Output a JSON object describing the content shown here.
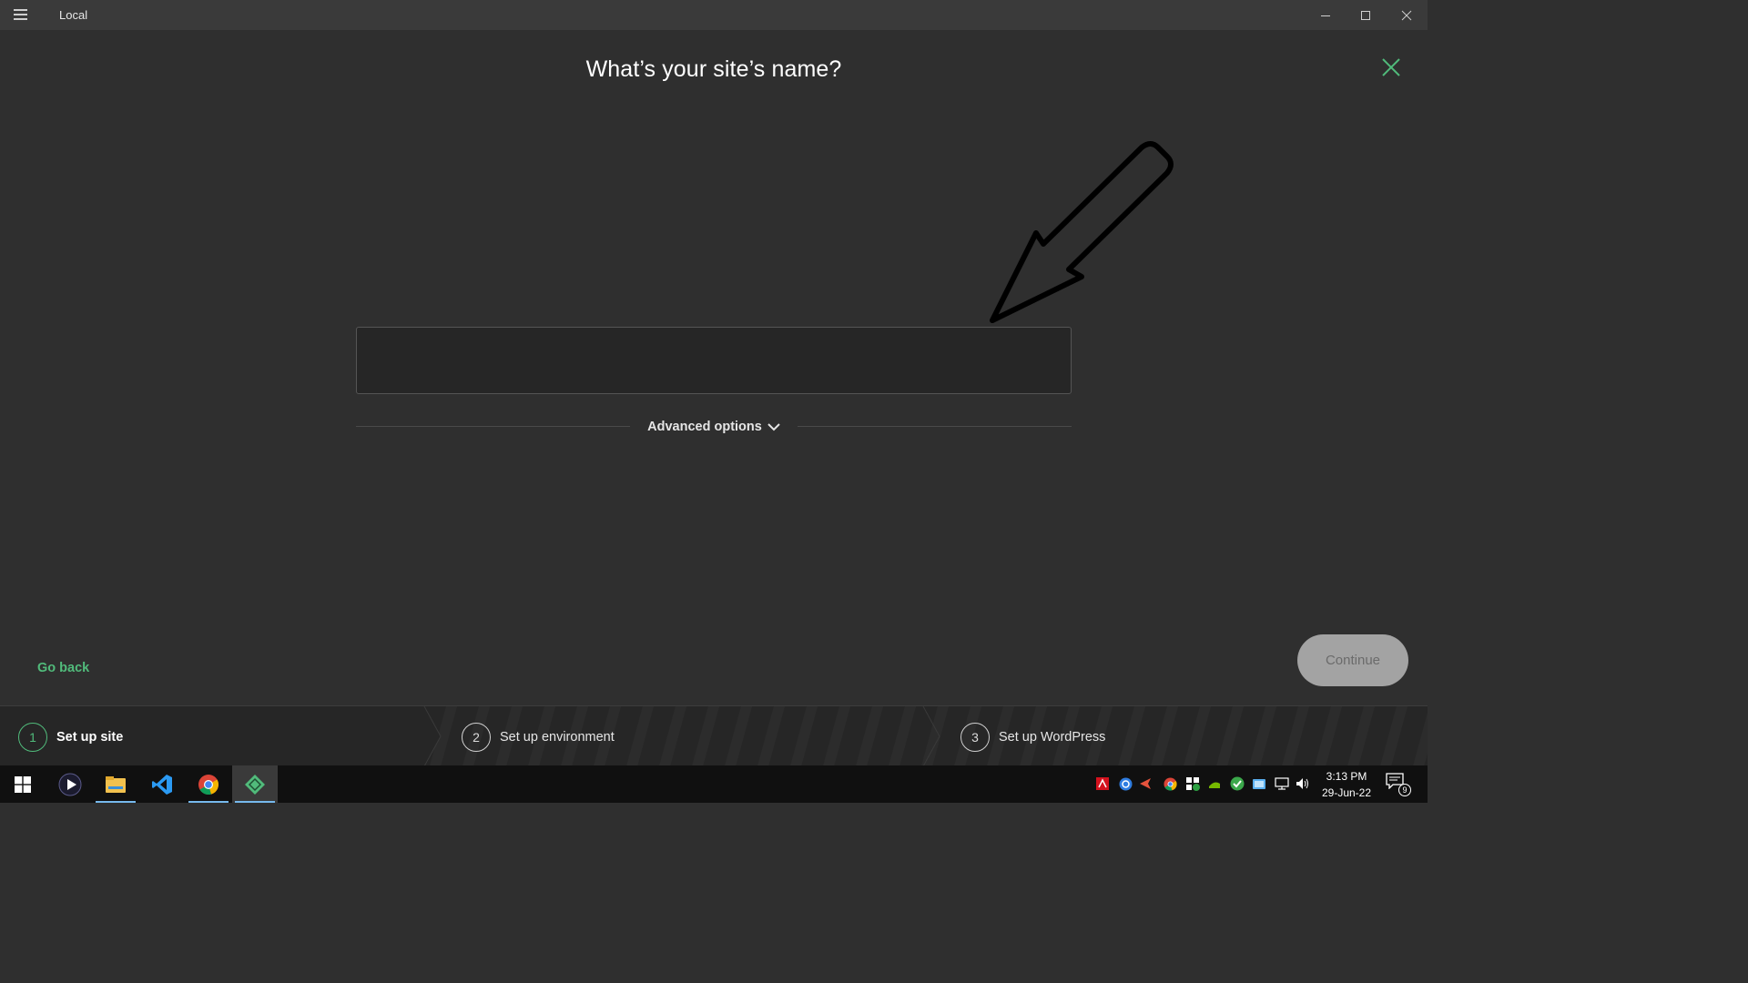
{
  "window": {
    "title": "Local"
  },
  "heading": "What’s your site’s name?",
  "site_name_input": {
    "value": "",
    "placeholder": ""
  },
  "advanced_options": {
    "label": "Advanced options"
  },
  "footer": {
    "go_back_label": "Go back",
    "continue_label": "Continue"
  },
  "steps": [
    {
      "number": "1",
      "label": "Set up site",
      "active": true
    },
    {
      "number": "2",
      "label": "Set up environment",
      "active": false
    },
    {
      "number": "3",
      "label": "Set up WordPress",
      "active": false
    }
  ],
  "taskbar": {
    "apps": [
      "media-player-icon",
      "file-explorer-icon",
      "vscode-icon",
      "chrome-icon",
      "local-app-icon"
    ],
    "tray_icons": [
      "adobe-icon",
      "browser-helper-icon",
      "send-icon",
      "chrome-icon",
      "security-icon",
      "nvidia-icon",
      "checkmark-icon",
      "cloud-icon",
      "network-icon",
      "volume-icon"
    ],
    "time": "3:13 PM",
    "date": "29-Jun-22",
    "notification_count": "9"
  },
  "colors": {
    "accent_green": "#51bb7b",
    "background": "#2f2f2f",
    "titlebar": "#3a3a3a",
    "stepper_bg": "#262626",
    "continue_disabled": "#a3a3a3",
    "taskbar": "#101010"
  }
}
